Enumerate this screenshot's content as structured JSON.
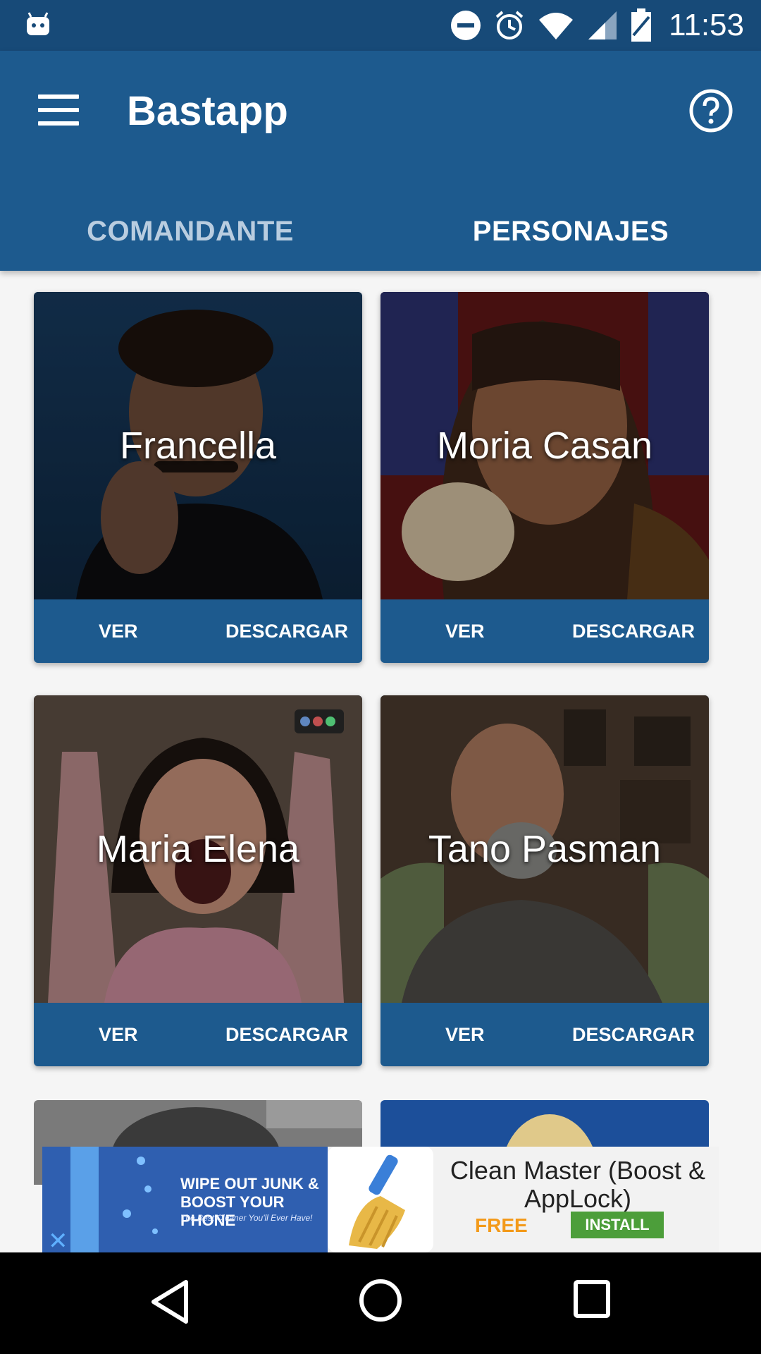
{
  "status_bar": {
    "time": "11:53"
  },
  "app_bar": {
    "title": "Bastapp"
  },
  "tabs": [
    {
      "label": "COMANDANTE",
      "active": false
    },
    {
      "label": "PERSONAJES",
      "active": true
    }
  ],
  "cards": [
    {
      "name": "Francella",
      "ver_label": "VER",
      "download_label": "DESCARGAR"
    },
    {
      "name": "Moria Casan",
      "ver_label": "VER",
      "download_label": "DESCARGAR"
    },
    {
      "name": "Maria Elena",
      "ver_label": "VER",
      "download_label": "DESCARGAR"
    },
    {
      "name": "Tano Pasman",
      "ver_label": "VER",
      "download_label": "DESCARGAR"
    }
  ],
  "ad": {
    "banner_line1": "WIPE OUT JUNK &",
    "banner_line2": "BOOST YOUR PHONE",
    "banner_tagline": "The Best Cleaner You'll Ever Have!",
    "app_name": "Clean Master (Boost & AppLock)",
    "price": "FREE",
    "install_label": "INSTALL"
  },
  "colors": {
    "primary": "#1d5a8e",
    "status_bar": "#174a78",
    "tab_inactive": "#b9cde0",
    "free": "#f39a1a",
    "install": "#4c9e3a"
  }
}
